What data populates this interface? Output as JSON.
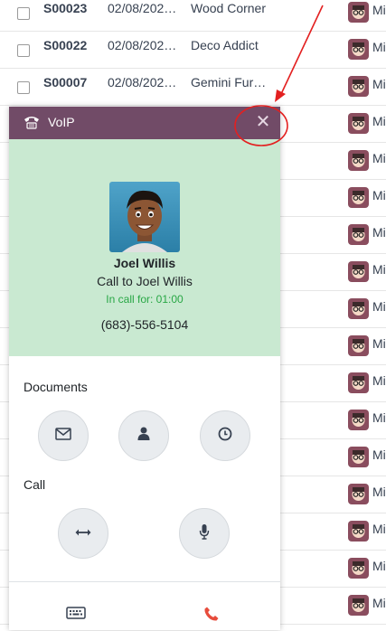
{
  "list": {
    "rows": [
      {
        "ref": "S00023",
        "date": "02/08/202…",
        "customer": "Wood Corner",
        "salesperson": "Mi"
      },
      {
        "ref": "S00022",
        "date": "02/08/202…",
        "customer": "Deco Addict",
        "salesperson": "Mi"
      },
      {
        "ref": "S00007",
        "date": "02/08/202…",
        "customer": "Gemini Fur…",
        "salesperson": "Mi"
      },
      {
        "salesperson": "Mi"
      },
      {
        "salesperson": "Mi"
      },
      {
        "salesperson": "Mi"
      },
      {
        "salesperson": "Mi"
      },
      {
        "salesperson": "Mi"
      },
      {
        "salesperson": "Mi"
      },
      {
        "salesperson": "Mi"
      },
      {
        "salesperson": "Mi"
      },
      {
        "salesperson": "Mi"
      },
      {
        "salesperson": "Mi"
      },
      {
        "salesperson": "Mi"
      },
      {
        "salesperson": "Mi"
      },
      {
        "salesperson": "Mi"
      },
      {
        "salesperson": "Mi"
      }
    ]
  },
  "voip": {
    "title": "VoIP",
    "close_symbol": "✕",
    "contact": {
      "name": "Joel Willis",
      "call_to": "Call to Joel Willis",
      "in_call": "In call for: 01:00",
      "phone": "(683)-556-5104"
    },
    "documents_label": "Documents",
    "call_label": "Call",
    "icons": {
      "documents": [
        "envelope-icon",
        "user-icon",
        "clock-icon"
      ],
      "call": [
        "transfer-icon",
        "microphone-icon"
      ],
      "footer": [
        "keyboard-icon",
        "hangup-icon"
      ]
    }
  },
  "colors": {
    "header": "#714b67",
    "contact_bg": "#c9e9d1",
    "in_call": "#28a745",
    "hangup": "#e74c3c",
    "annotation": "#e32020"
  }
}
